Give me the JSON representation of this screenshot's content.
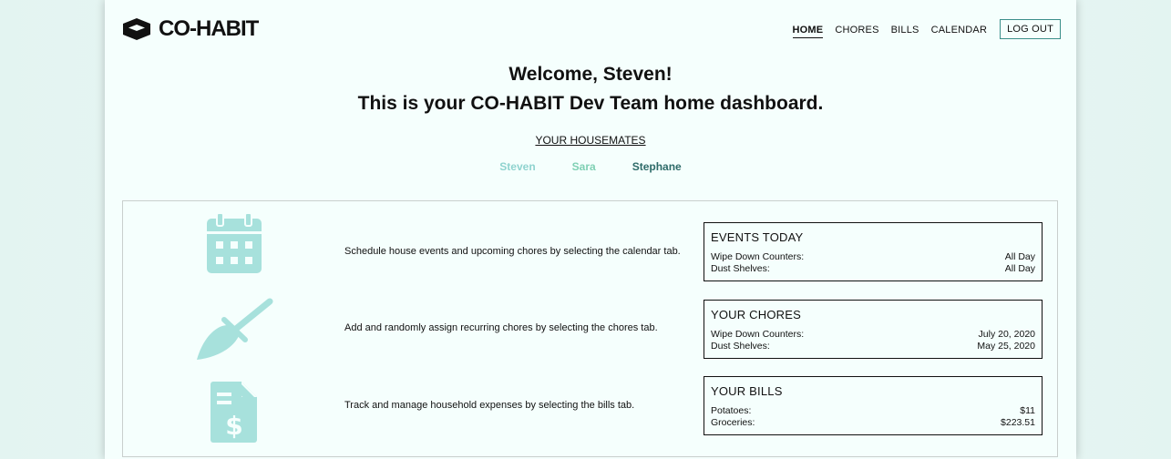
{
  "brand": {
    "name": "CO-HABIT"
  },
  "nav": {
    "items": [
      "HOME",
      "CHORES",
      "BILLS",
      "CALENDAR"
    ],
    "active": "HOME",
    "logout_label": "LOG OUT"
  },
  "welcome": {
    "title": "Welcome, Steven!",
    "subtitle": "This is your CO-HABIT Dev Team home dashboard."
  },
  "housemates": {
    "title": "YOUR HOUSEMATES",
    "members": [
      {
        "name": "Steven",
        "color": "#8fd3cf"
      },
      {
        "name": "Sara",
        "color": "#7fd0b4"
      },
      {
        "name": "Stephane",
        "color": "#2e6b69"
      }
    ]
  },
  "features": [
    {
      "icon": "calendar-icon",
      "text": "Schedule house events and upcoming chores by selecting the calendar tab."
    },
    {
      "icon": "broom-icon",
      "text": "Add and randomly assign recurring chores by selecting the chores tab."
    },
    {
      "icon": "bill-icon",
      "text": "Track and manage household expenses by selecting the bills tab."
    }
  ],
  "cards": {
    "events": {
      "title": "EVENTS TODAY",
      "rows": [
        {
          "label": "Wipe Down Counters:",
          "value": "All Day"
        },
        {
          "label": "Dust Shelves:",
          "value": "All Day"
        }
      ]
    },
    "chores": {
      "title": "YOUR CHORES",
      "rows": [
        {
          "label": "Wipe Down Counters:",
          "value": "July 20, 2020"
        },
        {
          "label": "Dust Shelves:",
          "value": "May 25, 2020"
        }
      ]
    },
    "bills": {
      "title": "YOUR BILLS",
      "rows": [
        {
          "label": "Potatoes:",
          "value": "$11"
        },
        {
          "label": "Groceries:",
          "value": "$223.51"
        }
      ]
    }
  },
  "colors": {
    "accent": "#a7e1dc",
    "border": "#3a8f8a",
    "page_bg": "#f5fffd"
  }
}
